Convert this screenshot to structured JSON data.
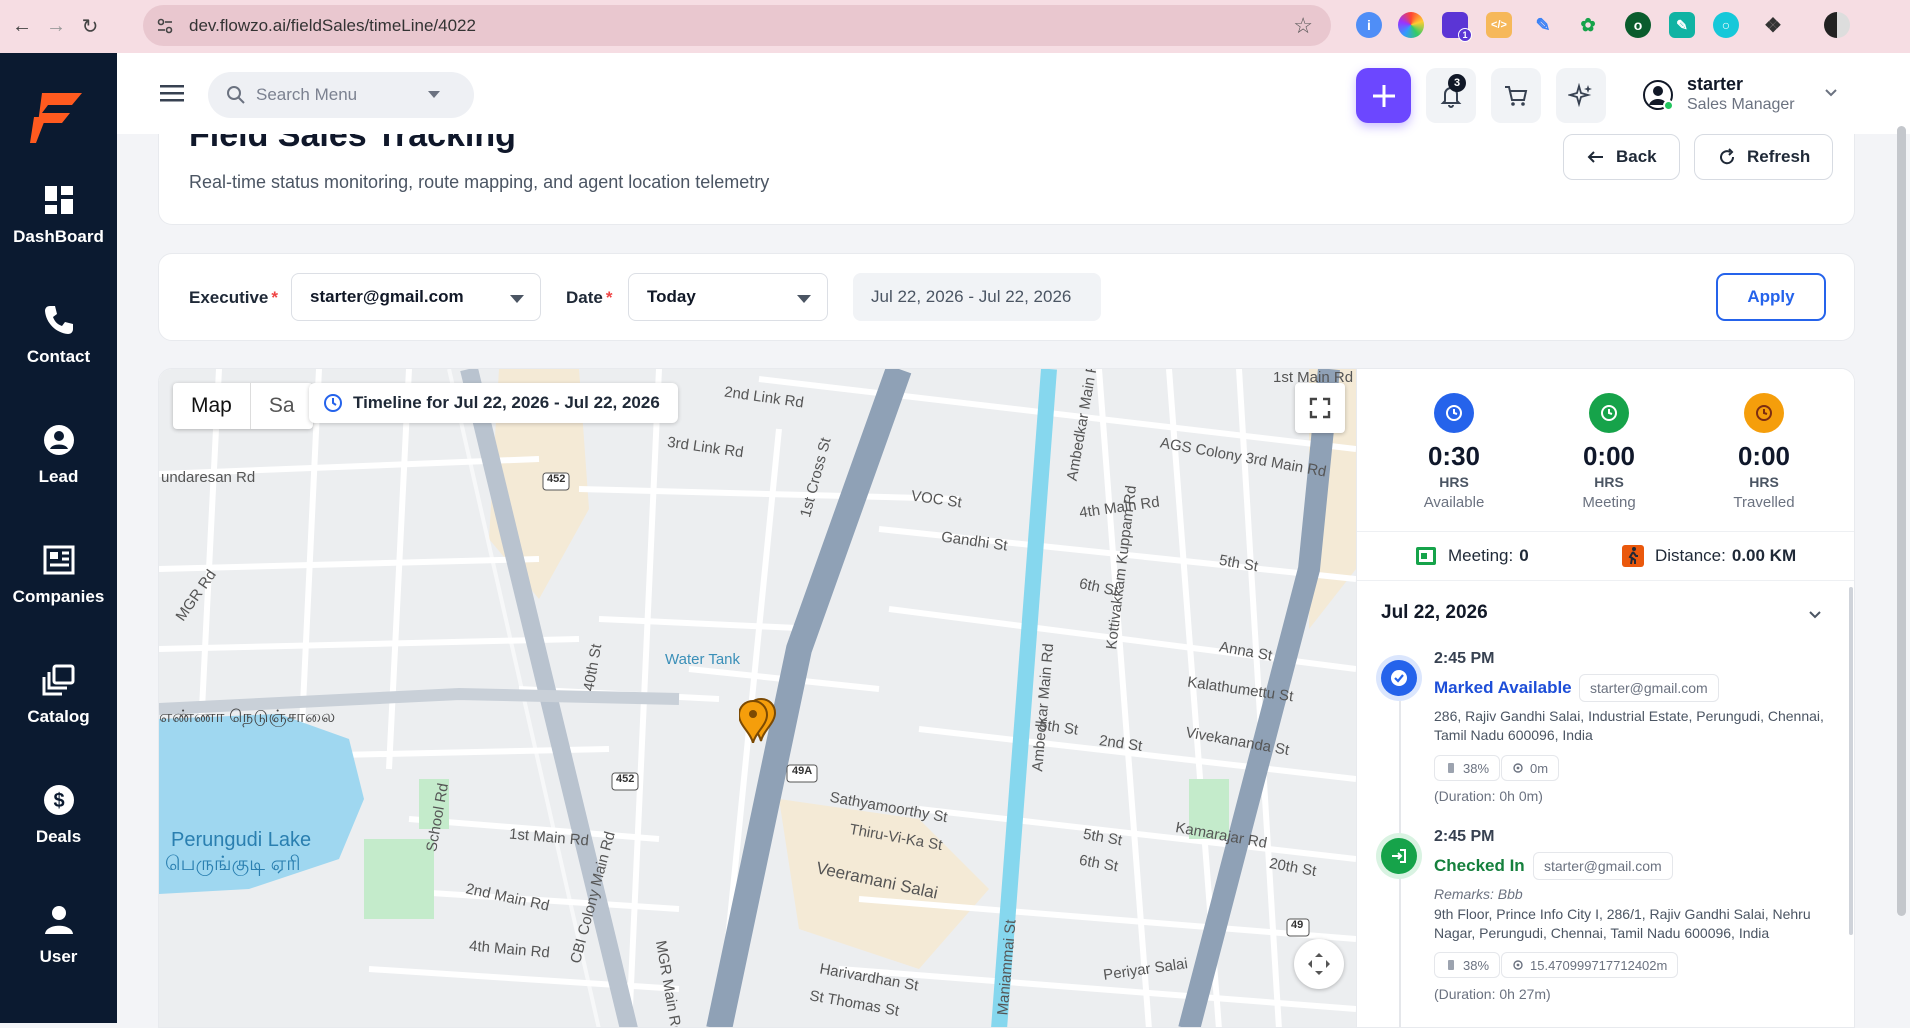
{
  "browser": {
    "url": "dev.flowzo.ai/fieldSales/timeLine/4022",
    "extension_badge": "1"
  },
  "sidebar": {
    "items": [
      {
        "label": "DashBoard",
        "icon": "dashboard-icon"
      },
      {
        "label": "Contact",
        "icon": "phone-icon"
      },
      {
        "label": "Lead",
        "icon": "user-circle-icon"
      },
      {
        "label": "Companies",
        "icon": "building-icon"
      },
      {
        "label": "Catalog",
        "icon": "catalog-icon"
      },
      {
        "label": "Deals",
        "icon": "dollar-icon"
      },
      {
        "label": "User",
        "icon": "user-icon"
      }
    ]
  },
  "header": {
    "search_placeholder": "Search Menu",
    "notification_count": "3",
    "user_name": "starter",
    "user_role": "Sales Manager",
    "accent": "#6c47ff"
  },
  "page": {
    "title": "Field Sales Tracking",
    "subtitle": "Real-time status monitoring, route mapping, and agent location telemetry",
    "back_label": "Back",
    "refresh_label": "Refresh"
  },
  "filters": {
    "executive_label": "Executive",
    "executive_value": "starter@gmail.com",
    "date_label": "Date",
    "date_value": "Today",
    "range_value": "Jul 22, 2026 - Jul 22, 2026",
    "required_mark": "*",
    "apply_label": "Apply"
  },
  "map": {
    "tab_map": "Map",
    "tab_satellite": "Sa",
    "timeline_label": "Timeline for Jul 22, 2026 - Jul 22, 2026",
    "labels": {
      "second_link_rd": "2nd Link Rd",
      "third_link_rd": "3rd Link Rd",
      "sundaresan_rd": "undaresan Rd",
      "mgr_rd": "MGR Rd",
      "water_tank": "Water Tank",
      "tamil_road": "எண்ணா நெடுஞ்சாலை",
      "lake_en": "Perungudi Lake",
      "lake_ta": "பெருங்குடி ஏரி",
      "first_main_rd": "1st Main Rd",
      "second_main_rd": "2nd Main Rd",
      "fourth_main_rd": "4th Main Rd",
      "school_rd": "School Rd",
      "cbi_colony": "CBI Colony Main Rd",
      "mgr_main_rd": "MGR Main Rd",
      "first_cross": "1st Cross St",
      "voc_st": "VOC St",
      "gandhi_st": "Gandhi St",
      "ambedkar_main": "Ambedkar Main Rd",
      "kottivakkam": "Kottivakkam Kuppam Rd",
      "ags_colony": "AGS Colony 3rd Main Rd",
      "fourth_main_rd2": "4th Main Rd",
      "fifth_st": "5th St",
      "sixth_st": "6th St",
      "anna_st": "Anna St",
      "kalathumettu": "Kalathumettu St",
      "vivekananda": "Vivekananda St",
      "second_st": "2nd St",
      "kamarajar": "Kamarajar Rd",
      "twentieth_st": "20th St",
      "sathyamoorthy": "Sathyamoorthy St",
      "thiru_vi_ka": "Thiru-Vi-Ka St",
      "veeramani": "Veeramani Salai",
      "maniammai": "Maniammai St",
      "periyar": "Periyar Salai",
      "harivardhan": "Harivardhan St",
      "st_thomas": "St Thomas St",
      "first_main_top": "1st Main Rd",
      "fortieth_st": "40th St",
      "route_452": "452",
      "route_49a": "49A",
      "route_49": "49"
    }
  },
  "stats": [
    {
      "value": "0:30",
      "unit": "HRS",
      "label": "Available",
      "color": "#2563eb"
    },
    {
      "value": "0:00",
      "unit": "HRS",
      "label": "Meeting",
      "color": "#16a34a"
    },
    {
      "value": "0:00",
      "unit": "HRS",
      "label": "Travelled",
      "color": "#f59e0b"
    }
  ],
  "summary": {
    "meeting_label": "Meeting:",
    "meeting_value": "0",
    "distance_label": "Distance:",
    "distance_value": "0.00 KM"
  },
  "timeline": {
    "date": "Jul 22, 2026",
    "entries": [
      {
        "time": "2:45 PM",
        "status": "Marked Available",
        "status_color": "#1d4ed8",
        "email": "starter@gmail.com",
        "address": "286, Rajiv Gandhi Salai, Industrial Estate, Perungudi, Chennai, Tamil Nadu 600096, India",
        "battery": "38%",
        "accuracy": "0m",
        "duration": "(Duration: 0h 0m)"
      },
      {
        "time": "2:45 PM",
        "status": "Checked In",
        "status_color": "#15803d",
        "email": "starter@gmail.com",
        "remarks": "Remarks: Bbb",
        "address": "9th Floor, Prince Info City I, 286/1, Rajiv Gandhi Salai, Nehru Nagar, Perungudi, Chennai, Tamil Nadu 600096, India",
        "battery": "38%",
        "accuracy": "15.470999717712402m",
        "duration": "(Duration: 0h 27m)"
      }
    ]
  }
}
